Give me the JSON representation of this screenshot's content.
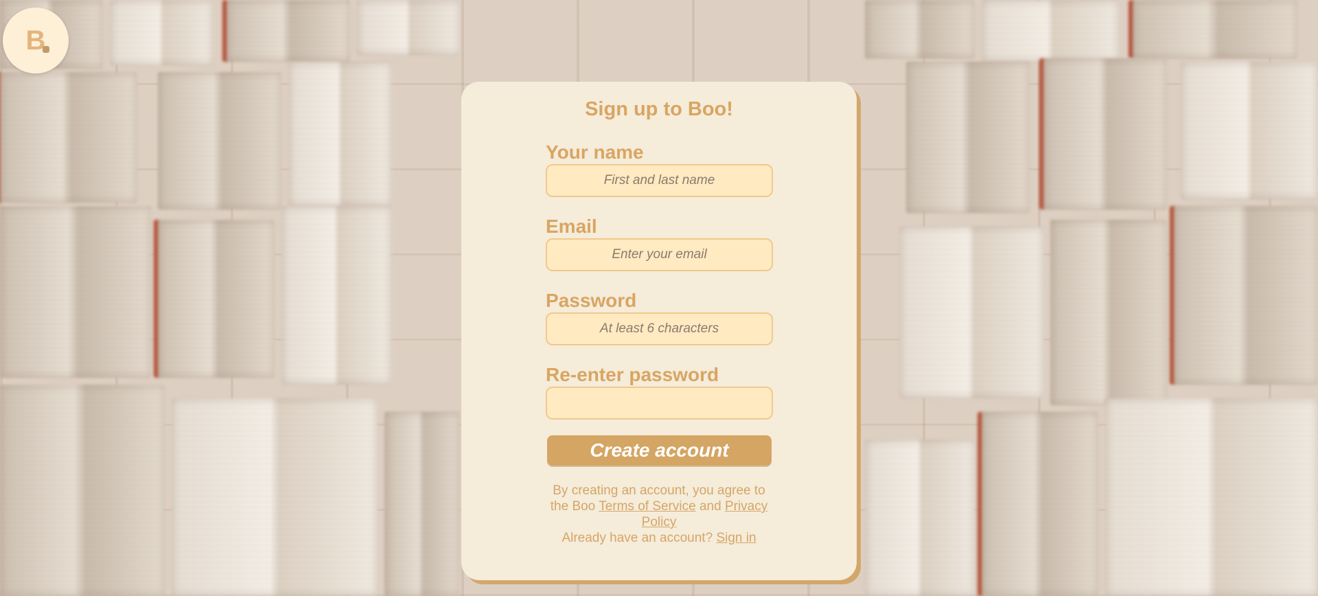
{
  "app": {
    "logo_letter": "B",
    "logo_icon": "bookmark-icon"
  },
  "signup": {
    "title": "Sign up to Boo!",
    "fields": [
      {
        "label": "Your name",
        "value": "",
        "placeholder": "First and last name"
      },
      {
        "label": "Email",
        "value": "",
        "placeholder": "Enter your email"
      },
      {
        "label": "Password",
        "value": "",
        "placeholder": "At least 6 characters"
      },
      {
        "label": "Re-enter password",
        "value": "",
        "placeholder": ""
      }
    ],
    "submit_label": "Create account",
    "legal": {
      "prefix": "By creating an account, you agree to the Boo",
      "terms_link": "Terms of Service",
      "and": "and",
      "privacy_link": "Privacy Policy"
    },
    "signin": {
      "prompt": "Already have an account?",
      "link": "Sign in"
    }
  },
  "colors": {
    "card_background": "#f5ecda",
    "accent": "#d9a562",
    "input_background": "#ffeac2",
    "input_border": "#f0c98b",
    "button_background": "#d4a563",
    "card_shadow": "#d3a66a"
  }
}
